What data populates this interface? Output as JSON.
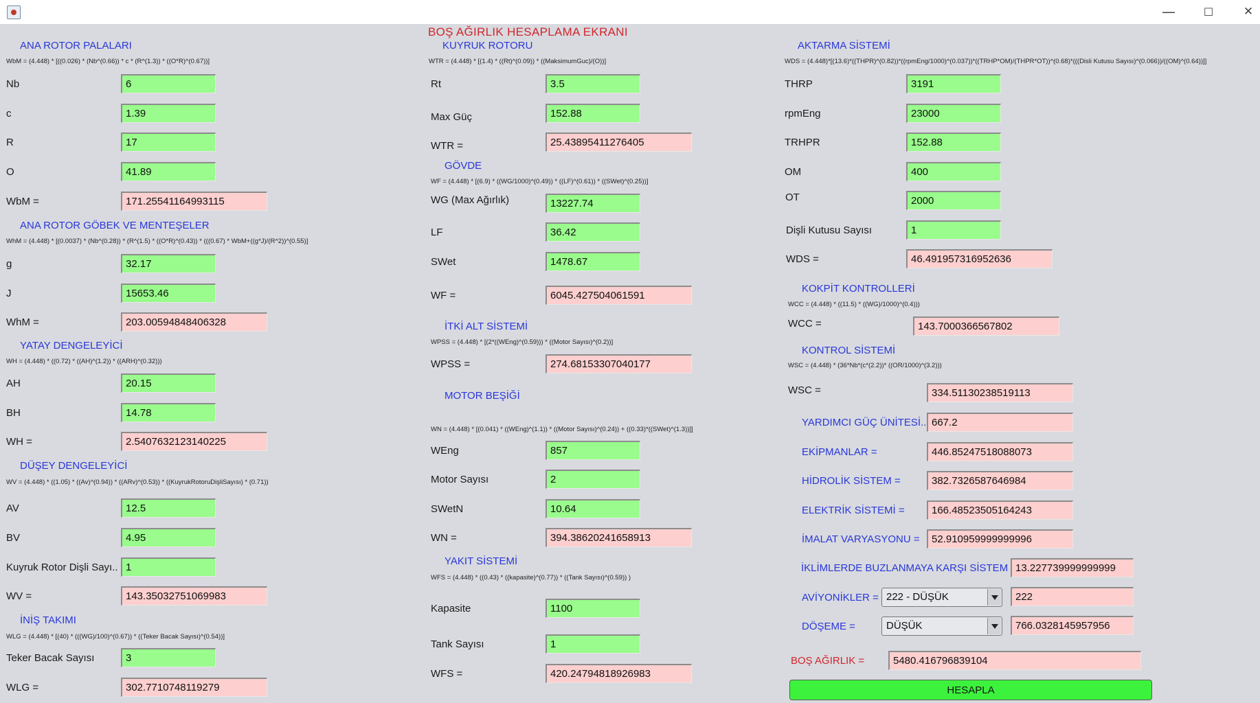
{
  "window": {
    "minimize": "—",
    "maximize": "☐",
    "close": "✕"
  },
  "screen_title": "BOŞ AĞIRLIK HESAPLAMA EKRANI",
  "col1": {
    "ana_rotor": {
      "title": "ANA ROTOR PALALARI",
      "formula": "WbM = (4.448) * [((0.026) * (Nb^(0.66)) * c * (R^(1.3)) * ((O*R)^(0.67))]",
      "nb_label": "Nb",
      "nb": "6",
      "c_label": "c",
      "c": "1.39",
      "r_label": "R",
      "r": "17",
      "o_label": "O",
      "o": "41.89",
      "wbm_label": "WbM =",
      "wbm": "171.25541164993115"
    },
    "gobek": {
      "title": "ANA ROTOR GÖBEK VE MENTEŞELER",
      "formula": "WhM = (4.448) * [(0.0037) * (Nb^(0.28)) * (R^(1.5) * ((O*R)^(0.43)) * (((0.67) * WbM+((g*J)/(R^2))^(0.55)]",
      "g_label": "g",
      "g": "32.17",
      "j_label": "J",
      "j": "15653.46",
      "whm_label": "WhM =",
      "whm": "203.00594848406328"
    },
    "yatay": {
      "title": "YATAY DENGELEYİCİ",
      "formula": "WH = (4.448) * ((0.72) * ((AH)^(1.2)) * ((ARH)^(0.32)))",
      "ah_label": "AH",
      "ah": "20.15",
      "bh_label": "BH",
      "bh": "14.78",
      "wh_label": "WH =",
      "wh": "2.5407632123140225"
    },
    "duesey": {
      "title": "DÜŞEY DENGELEYİCİ",
      "formula": "WV = (4.448) * ((1.05) * ((Av)^(0.94)) * ((ARv)^(0.53)) * ((KuyrukRotoruDişliSayısı) * (0.71))",
      "av_label": "AV",
      "av": "12.5",
      "bv_label": "BV",
      "bv": "4.95",
      "kr_label": "Kuyruk Rotor Dişli Sayı..",
      "kr": "1",
      "wv_label": "WV =",
      "wv": "143.35032751069983"
    },
    "inis": {
      "title": "İNİŞ TAKIMI",
      "formula": "WLG = (4.448) * [(40) * (((WG)/100)^(0.67)) * ((Teker Bacak Sayısı)^(0.54))]",
      "tb_label": "Teker Bacak Sayısı",
      "tb": "3",
      "wlg_label": "WLG =",
      "wlg": "302.7710748119279"
    }
  },
  "col2": {
    "kuyruk": {
      "title": "KUYRUK ROTORU",
      "formula": "WTR = (4.448) * [(1.4) * ((Rt)^(0.09)) * ((MaksimumGuc)/(O))]",
      "rt_label": "Rt",
      "rt": "3.5",
      "mg_label": "Max Güç",
      "mg": "152.88",
      "wtr_label": "WTR =",
      "wtr": "25.43895411276405"
    },
    "govde": {
      "title": "GÖVDE",
      "formula": "WF = (4.448) * [(6.9) * ((WG/1000)^(0.49)) * ((LF)^(0.61)) * ((SWet)^(0.25))]",
      "wg_label": "WG (Max Ağırlık)",
      "wg": "13227.74",
      "lf_label": "LF",
      "lf": "36.42",
      "swet_label": "SWet",
      "swet": "1478.67",
      "wf_label": "WF =",
      "wf": "6045.427504061591"
    },
    "itki": {
      "title": "İTKİ ALT SİSTEMİ",
      "formula": "WPSS = (4.448) * [(2*((WEng)^(0.59))) * ((Motor Sayısı)^(0.2))]",
      "wpss_label": "WPSS =",
      "wpss": "274.68153307040177"
    },
    "motor": {
      "title": "MOTOR BEŞİĞİ",
      "formula": "WN = (4.448) * [(0.041) * ((WEng)^(1.1)) * ((Motor Sayısı)^(0.24)) + ((0.33)*((SWet)^(1.3))]]",
      "weng_label": "WEng",
      "weng": "857",
      "ms_label": "Motor Sayısı",
      "ms": "2",
      "swetn_label": "SWetN",
      "swetn": "10.64",
      "wn_label": "WN =",
      "wn": "394.38620241658913"
    },
    "yakit": {
      "title": "YAKIT SİSTEMİ",
      "formula": "WFS = (4.448) * ((0.43) * ((kapasite)^(0.77)) * ((Tank Sayısı)^(0.59)) )",
      "kap_label": "Kapasite",
      "kap": "1100",
      "ts_label": "Tank Sayısı",
      "ts": "1",
      "wfs_label": "WFS =",
      "wfs": "420.24794818926983"
    }
  },
  "col3": {
    "aktarma": {
      "title": "AKTARMA SİSTEMİ",
      "formula": "WDS = (4.448)*[(13.6)*((THPR)^(0.82))*((rpmEng/1000)^(0.037))*((TRHP*OM)/(THPR*OT))^(0.68)*(((Disli Kutusu Sayısı)^(0.066))/((OM)^(0.64))]]",
      "thrp_label": "THRP",
      "thrp": "3191",
      "rpm_label": "rpmEng",
      "rpm": "23000",
      "trhpr_label": "TRHPR",
      "trhpr": "152.88",
      "om_label": "OM",
      "om": "400",
      "ot_label": "OT",
      "ot": "2000",
      "dks_label": "Dişli Kutusu Sayısı",
      "dks": "1",
      "wds_label": "WDS =",
      "wds": "46.491957316952636"
    },
    "kokpit": {
      "title": "KOKPİT KONTROLLERİ",
      "formula": "WCC = (4.448) * ((11.5) * ((WG)/1000)^(0.4)))",
      "wcc_label": "WCC =",
      "wcc": "143.7000366567802"
    },
    "kontrol": {
      "title": "KONTROL SİSTEMİ",
      "formula": "WSC = (4.448) * (36*Nb*(c*(2.2))* ((OR/1000)^(3.2)))",
      "wsc_label": "WSC =",
      "wsc": "334.51130238519113"
    },
    "yardimci_label": "YARDIMCI GÜÇ ÜNİTESİ..",
    "yardimci": "667.2",
    "ekipman_label": "EKİPMANLAR =",
    "ekipman": "446.85247518088073",
    "hidrolik_label": "HİDROLİK SİSTEM =",
    "hidrolik": "382.7326587646984",
    "elektrik_label": "ELEKTRİK SİSTEMİ =",
    "elektrik": "166.48523505164243",
    "imalat_label": "İMALAT VARYASYONU =",
    "imalat": "52.910959999999996",
    "buz_label": "İKLİMLERDE BUZLANMAYA KARŞI SİSTEM =",
    "buz": "13.227739999999999",
    "aviyonik_label": "AVİYONİKLER =",
    "aviyonik_select": "222   - DÜŞÜK",
    "aviyonik": "222",
    "doseme_label": "DÖŞEME =",
    "doseme_select": "DÜŞÜK",
    "doseme": "766.0328145957956",
    "bos_label": "BOŞ AĞIRLIK =",
    "bos": "5480.416796839104",
    "hesapla": "HESAPLA"
  }
}
